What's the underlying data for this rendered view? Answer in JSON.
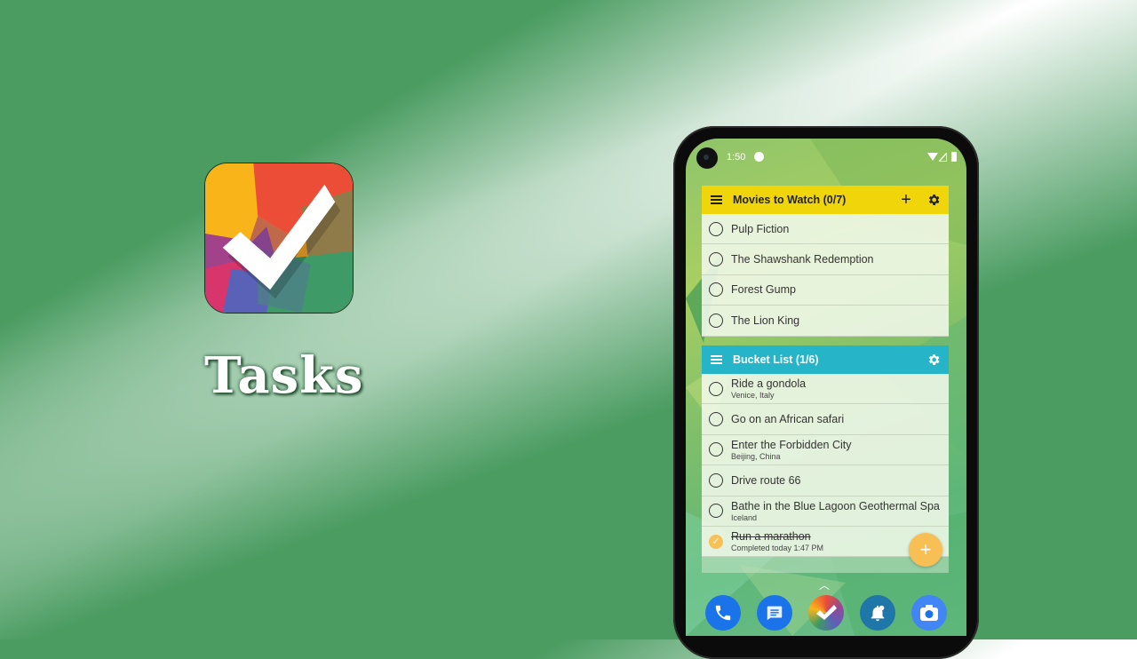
{
  "promo": {
    "app_name": "Tasks",
    "icon": "tasks-app-icon"
  },
  "status_bar": {
    "time": "1:50",
    "notification_icon": "data-saver-icon",
    "right_icons": [
      "wifi-icon",
      "signal-icon",
      "battery-icon"
    ]
  },
  "widgets": [
    {
      "title": "Movies to Watch (0/7)",
      "header_color": "#f0d50a",
      "header_text_color": "#222222",
      "menu_icon": "list-icon",
      "actions": [
        "add-icon",
        "settings-icon"
      ],
      "items": [
        {
          "title": "Pulp Fiction",
          "note": "",
          "done": false
        },
        {
          "title": "The Shawshank Redemption",
          "note": "",
          "done": false
        },
        {
          "title": "Forest Gump",
          "note": "",
          "done": false
        },
        {
          "title": "The Lion King",
          "note": "",
          "done": false
        }
      ]
    },
    {
      "title": "Bucket List (1/6)",
      "header_color": "#26b5c8",
      "header_text_color": "#ffffff",
      "menu_icon": "list-icon",
      "actions": [
        "settings-icon"
      ],
      "items": [
        {
          "title": "Ride a gondola",
          "note": "Venice, Italy",
          "done": false
        },
        {
          "title": "Go on an African safari",
          "note": "",
          "done": false
        },
        {
          "title": "Enter the Forbidden City",
          "note": "Beijing, China",
          "done": false
        },
        {
          "title": "Drive route 66",
          "note": "",
          "done": false
        },
        {
          "title": "Bathe in the Blue Lagoon Geothermal Spa",
          "note": "Iceland",
          "done": false
        },
        {
          "title": "Run a marathon",
          "note": "Completed today 1:47 PM",
          "done": true
        }
      ]
    }
  ],
  "fab": {
    "icon": "add-icon",
    "label": "+"
  },
  "dock": {
    "apps": [
      {
        "name": "phone",
        "icon": "phone-icon",
        "color": "#1a73e8"
      },
      {
        "name": "messages",
        "icon": "message-icon",
        "color": "#1a73e8"
      },
      {
        "name": "tasks",
        "icon": "tasks-app-icon",
        "color": "#e8543a"
      },
      {
        "name": "reminders",
        "icon": "bell-icon",
        "color": "#1f76a8"
      },
      {
        "name": "camera",
        "icon": "camera-icon",
        "color": "#4285f4"
      }
    ]
  }
}
